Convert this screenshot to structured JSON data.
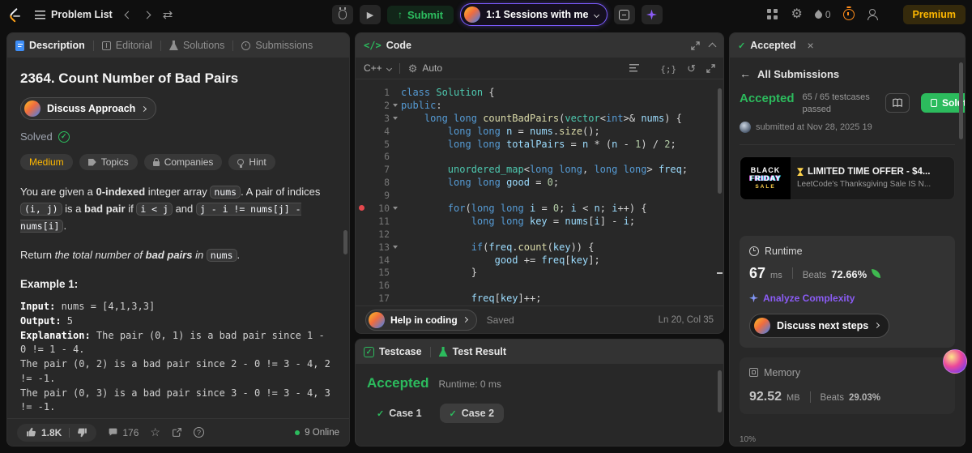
{
  "navbar": {
    "problem_list_label": "Problem List",
    "submit_label": "Submit",
    "sessions_label": "1:1 Sessions with me",
    "streak_count": "0",
    "premium_label": "Premium"
  },
  "tabs": {
    "description": "Description",
    "editorial": "Editorial",
    "solutions": "Solutions",
    "submissions": "Submissions"
  },
  "problem": {
    "title": "2364. Count Number of Bad Pairs",
    "discuss_approach_label": "Discuss Approach",
    "solved_label": "Solved",
    "difficulty": "Medium",
    "topics_label": "Topics",
    "companies_label": "Companies",
    "hint_label": "Hint",
    "statement": {
      "s0": "You are given a ",
      "s1": "0-indexed",
      "s2": " integer array ",
      "s3": "nums",
      "s4": ". A pair of indices ",
      "s5": "(i, j)",
      "s6": " is a ",
      "s7": "bad pair",
      "s8": " if ",
      "s9": "i < j",
      "s10": " and ",
      "s11": "j - i != nums[j] - nums[i]",
      "s12": "."
    },
    "return_line": {
      "r0": "Return ",
      "r1": "the total number of ",
      "r2": "bad pairs",
      "r3": " in ",
      "r4": "nums",
      "r5": "."
    },
    "example1": {
      "heading": "Example 1:",
      "input_label": "Input:",
      "input_value": " nums = [4,1,3,3]",
      "output_label": "Output:",
      "output_value": " 5",
      "explanation_label": "Explanation:",
      "explanation_value": " The pair (0, 1) is a bad pair since 1 - 0 != 1 - 4.\nThe pair (0, 2) is a bad pair since 2 - 0 != 3 - 4, 2 != -1.\nThe pair (0, 3) is a bad pair since 3 - 0 != 3 - 4, 3 != -1."
    },
    "footer": {
      "likes": "1.8K",
      "comments": "176",
      "online": "9 Online"
    }
  },
  "code_panel": {
    "header_label": "Code",
    "language": "C++",
    "auto_label": "Auto",
    "help_label": "Help in coding",
    "saved_label": "Saved",
    "cursor_pos": "Ln 20, Col 35"
  },
  "test_panel": {
    "testcase_label": "Testcase",
    "result_label": "Test Result",
    "status": "Accepted",
    "runtime_label": "Runtime: 0 ms",
    "case1": "Case 1",
    "case2": "Case 2"
  },
  "result_panel": {
    "tab_label": "Accepted",
    "back_label": "All Submissions",
    "status": "Accepted",
    "testcases_line1": "65 / 65 testcases",
    "testcases_line2": "passed",
    "submitted": "submitted at Nov 28, 2025 19",
    "solution_label": "Solution",
    "banner": {
      "img_line1": "BLACK",
      "img_line2": "FRIDAY",
      "img_line3": "SALE",
      "title": "LIMITED TIME OFFER - $4...",
      "subtitle": "LeetCode's Thanksgiving Sale IS N..."
    },
    "runtime": {
      "label": "Runtime",
      "value": "67",
      "unit": "ms",
      "beats_label": "Beats",
      "beats_value": "72.66%",
      "analyze_label": "Analyze Complexity",
      "discuss_label": "Discuss next steps"
    },
    "memory": {
      "label": "Memory",
      "value": "92.52",
      "unit": "MB",
      "beats_label": "Beats",
      "beats_value": "29.03%"
    },
    "chart_tick": "10%"
  },
  "colors": {
    "accent_green": "#2cbb5d",
    "difficulty_yellow": "#ffb800",
    "premium_gold": "#ffb800",
    "ai_purple": "#8b5cf6"
  },
  "code_lines": [
    {
      "n": "1",
      "tokens": [
        [
          "kw",
          "class"
        ],
        [
          "pl",
          " "
        ],
        [
          "ty",
          "Solution"
        ],
        [
          "pl",
          " {"
        ]
      ]
    },
    {
      "n": "2",
      "fold": true,
      "tokens": [
        [
          "kw",
          "public"
        ],
        [
          "pl",
          ":"
        ]
      ]
    },
    {
      "n": "3",
      "fold": true,
      "tokens": [
        [
          "pl",
          "    "
        ],
        [
          "kw",
          "long"
        ],
        [
          "pl",
          " "
        ],
        [
          "kw",
          "long"
        ],
        [
          "pl",
          " "
        ],
        [
          "fn",
          "countBadPairs"
        ],
        [
          "pl",
          "("
        ],
        [
          "ty",
          "vector"
        ],
        [
          "pl",
          "<"
        ],
        [
          "kw",
          "int"
        ],
        [
          "pl",
          ">& "
        ],
        [
          "va",
          "nums"
        ],
        [
          "pl",
          ") {"
        ]
      ]
    },
    {
      "n": "4",
      "tokens": [
        [
          "pl",
          "        "
        ],
        [
          "kw",
          "long"
        ],
        [
          "pl",
          " "
        ],
        [
          "kw",
          "long"
        ],
        [
          "pl",
          " "
        ],
        [
          "va",
          "n"
        ],
        [
          "pl",
          " = "
        ],
        [
          "va",
          "nums"
        ],
        [
          "pl",
          "."
        ],
        [
          "fn",
          "size"
        ],
        [
          "pl",
          "();"
        ]
      ]
    },
    {
      "n": "5",
      "tokens": [
        [
          "pl",
          "        "
        ],
        [
          "kw",
          "long"
        ],
        [
          "pl",
          " "
        ],
        [
          "kw",
          "long"
        ],
        [
          "pl",
          " "
        ],
        [
          "va",
          "totalPairs"
        ],
        [
          "pl",
          " = "
        ],
        [
          "va",
          "n"
        ],
        [
          "pl",
          " * ("
        ],
        [
          "va",
          "n"
        ],
        [
          "pl",
          " - "
        ],
        [
          "nu",
          "1"
        ],
        [
          "pl",
          ") / "
        ],
        [
          "nu",
          "2"
        ],
        [
          "pl",
          ";"
        ]
      ]
    },
    {
      "n": "6",
      "tokens": []
    },
    {
      "n": "7",
      "tokens": [
        [
          "pl",
          "        "
        ],
        [
          "ty",
          "unordered_map"
        ],
        [
          "pl",
          "<"
        ],
        [
          "kw",
          "long"
        ],
        [
          "pl",
          " "
        ],
        [
          "kw",
          "long"
        ],
        [
          "pl",
          ", "
        ],
        [
          "kw",
          "long"
        ],
        [
          "pl",
          " "
        ],
        [
          "kw",
          "long"
        ],
        [
          "pl",
          "> "
        ],
        [
          "va",
          "freq"
        ],
        [
          "pl",
          ";"
        ]
      ]
    },
    {
      "n": "8",
      "tokens": [
        [
          "pl",
          "        "
        ],
        [
          "kw",
          "long"
        ],
        [
          "pl",
          " "
        ],
        [
          "kw",
          "long"
        ],
        [
          "pl",
          " "
        ],
        [
          "va",
          "good"
        ],
        [
          "pl",
          " = "
        ],
        [
          "nu",
          "0"
        ],
        [
          "pl",
          ";"
        ]
      ]
    },
    {
      "n": "9",
      "tokens": []
    },
    {
      "n": "10",
      "bp": true,
      "fold": true,
      "tokens": [
        [
          "pl",
          "        "
        ],
        [
          "kw",
          "for"
        ],
        [
          "pl",
          "("
        ],
        [
          "kw",
          "long"
        ],
        [
          "pl",
          " "
        ],
        [
          "kw",
          "long"
        ],
        [
          "pl",
          " "
        ],
        [
          "va",
          "i"
        ],
        [
          "pl",
          " = "
        ],
        [
          "nu",
          "0"
        ],
        [
          "pl",
          "; "
        ],
        [
          "va",
          "i"
        ],
        [
          "pl",
          " < "
        ],
        [
          "va",
          "n"
        ],
        [
          "pl",
          "; "
        ],
        [
          "va",
          "i"
        ],
        [
          "pl",
          "++) {"
        ]
      ]
    },
    {
      "n": "11",
      "tokens": [
        [
          "pl",
          "            "
        ],
        [
          "kw",
          "long"
        ],
        [
          "pl",
          " "
        ],
        [
          "kw",
          "long"
        ],
        [
          "pl",
          " "
        ],
        [
          "va",
          "key"
        ],
        [
          "pl",
          " = "
        ],
        [
          "va",
          "nums"
        ],
        [
          "pl",
          "["
        ],
        [
          "va",
          "i"
        ],
        [
          "pl",
          "] - "
        ],
        [
          "va",
          "i"
        ],
        [
          "pl",
          ";"
        ]
      ]
    },
    {
      "n": "12",
      "tokens": []
    },
    {
      "n": "13",
      "fold": true,
      "tokens": [
        [
          "pl",
          "            "
        ],
        [
          "kw",
          "if"
        ],
        [
          "pl",
          "("
        ],
        [
          "va",
          "freq"
        ],
        [
          "pl",
          "."
        ],
        [
          "fn",
          "count"
        ],
        [
          "pl",
          "("
        ],
        [
          "va",
          "key"
        ],
        [
          "pl",
          ")) {"
        ]
      ]
    },
    {
      "n": "14",
      "tokens": [
        [
          "pl",
          "                "
        ],
        [
          "va",
          "good"
        ],
        [
          "pl",
          " += "
        ],
        [
          "va",
          "freq"
        ],
        [
          "pl",
          "["
        ],
        [
          "va",
          "key"
        ],
        [
          "pl",
          "];"
        ]
      ]
    },
    {
      "n": "15",
      "tokens": [
        [
          "pl",
          "            }"
        ]
      ]
    },
    {
      "n": "16",
      "tokens": []
    },
    {
      "n": "17",
      "tokens": [
        [
          "pl",
          "            "
        ],
        [
          "va",
          "freq"
        ],
        [
          "pl",
          "["
        ],
        [
          "va",
          "key"
        ],
        [
          "pl",
          "]++;"
        ]
      ]
    }
  ]
}
